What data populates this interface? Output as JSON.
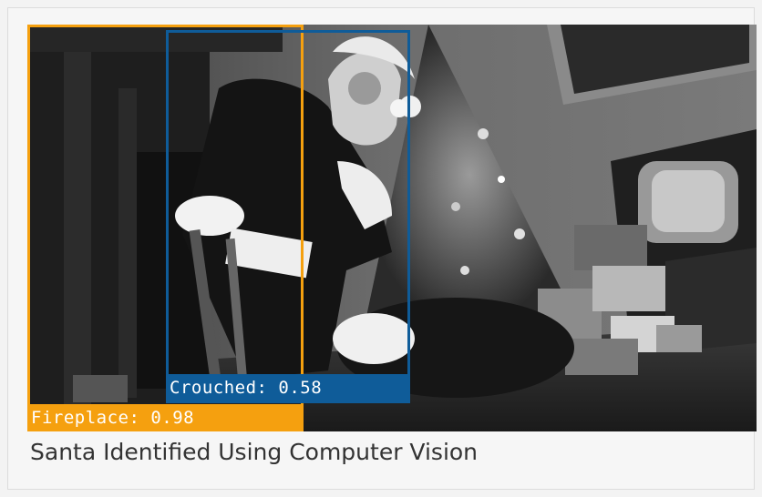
{
  "caption": "Santa Identified Using Computer Vision",
  "detections": [
    {
      "label": "Fireplace: 0.98",
      "class": "Fireplace",
      "confidence": 0.98,
      "color": "#f5a00f",
      "label_text_color": "#ffffff"
    },
    {
      "label": "Crouched: 0.58",
      "class": "Crouched",
      "confidence": 0.58,
      "color": "#0f5c99",
      "label_text_color": "#ffffff"
    }
  ],
  "image": {
    "mode": "grayscale",
    "scene": "santa-by-christmas-tree"
  }
}
